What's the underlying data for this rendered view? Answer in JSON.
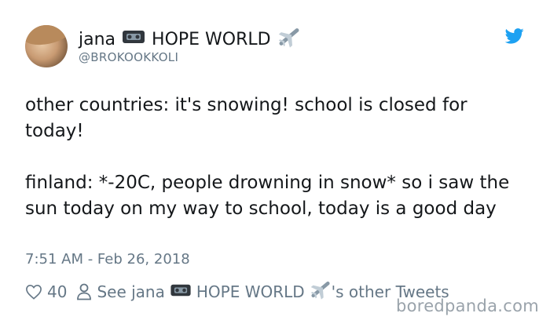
{
  "tweet": {
    "author_name": "jana",
    "author_suffix": "HOPE WORLD",
    "handle": "@BROKOOKKOLI",
    "body_line1": "other countries: it's snowing! school is closed for today!",
    "body_line2": "finland: *-20C, people drowning in snow* so i saw the sun today on my way to school, today is a good day",
    "timestamp": "7:51 AM - Feb 26, 2018",
    "likes": "40",
    "see_prefix": "See jana",
    "see_world": "HOPE WORLD",
    "see_suffix": "'s other Tweets"
  },
  "icons": {
    "brand": "twitter-bird-icon",
    "like": "heart-icon",
    "profile": "person-icon",
    "tape": "videocassette-icon",
    "plane": "airplane-icon"
  },
  "colors": {
    "twitter_blue": "#1da1f2",
    "secondary_text": "#657786",
    "text": "#14171a"
  },
  "watermark": "boredpanda.com"
}
